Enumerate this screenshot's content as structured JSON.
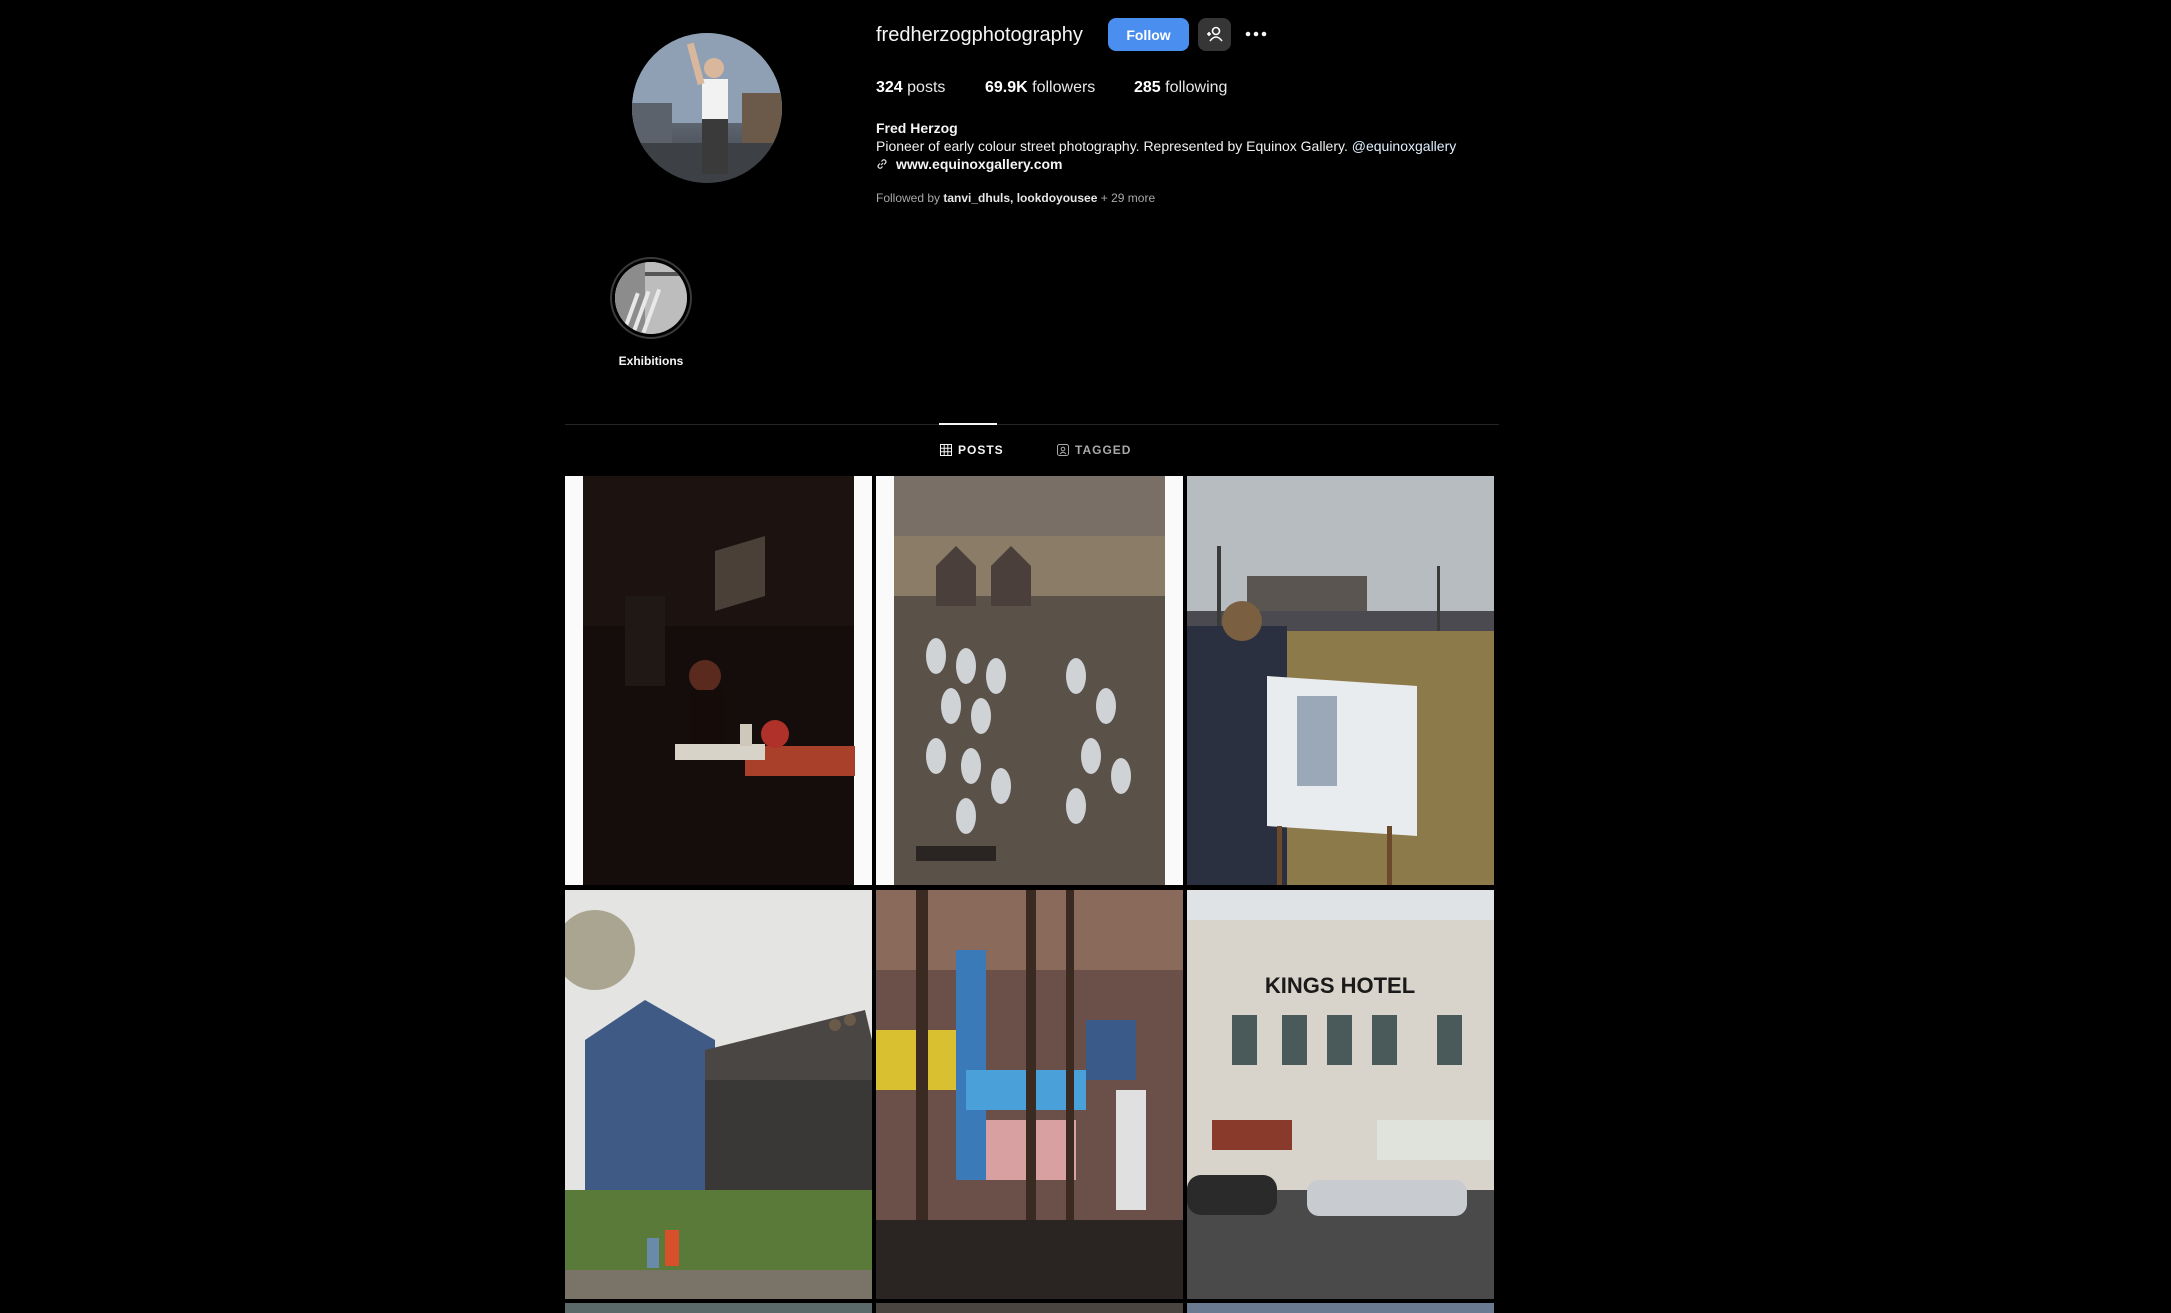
{
  "profile": {
    "username": "fredherzogphotography",
    "follow_label": "Follow",
    "posts_count": "324",
    "posts_label": "posts",
    "followers_count": "69.9K",
    "followers_label": "followers",
    "following_count": "285",
    "following_label": "following",
    "full_name": "Fred Herzog",
    "bio": "Pioneer of early colour street photography. Represented by Equinox Gallery.",
    "bio_handle": "@equinoxgallery",
    "website": "www.equinoxgallery.com",
    "followed_by_prefix": "Followed by",
    "followed_by_names": "tanvi_dhuls, lookdoyousee",
    "followed_by_more": "+ 29 more"
  },
  "highlights": [
    {
      "label": "Exhibitions"
    }
  ],
  "tabs": [
    {
      "label": "POSTS",
      "active": true
    },
    {
      "label": "TAGGED",
      "active": false
    }
  ],
  "grid": {
    "kings_hotel_sign": "KINGS HOTEL"
  },
  "colors": {
    "background": "#000000",
    "follow_button": "#4a8ff0",
    "secondary_button": "#363636",
    "muted_text": "#a8a8a8"
  },
  "icons": {
    "suggest": "add-person-icon",
    "more": "more-options-icon",
    "link": "link-icon",
    "posts_tab": "grid-icon",
    "tagged_tab": "tagged-icon"
  }
}
